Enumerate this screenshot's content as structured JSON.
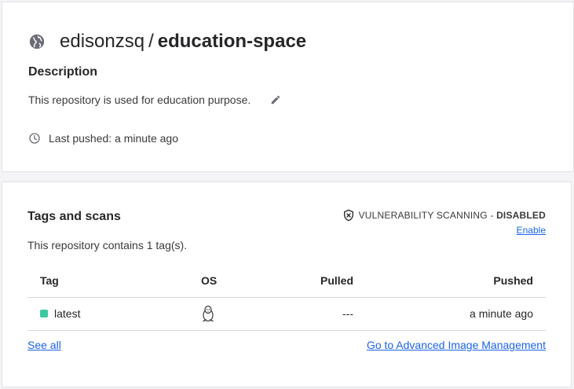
{
  "repo": {
    "owner": "edisonzsq",
    "separator": "/",
    "name": "education-space",
    "description_heading": "Description",
    "description": "This repository is used for education purpose.",
    "last_pushed": "Last pushed: a minute ago",
    "icons": {
      "visibility": "globe-icon",
      "edit": "pencil-icon",
      "time": "clock-icon"
    }
  },
  "tags": {
    "heading": "Tags and scans",
    "vuln_label": "VULNERABILITY SCANNING - ",
    "vuln_state": "DISABLED",
    "enable_label": "Enable",
    "count_text": "This repository contains 1 tag(s).",
    "columns": [
      "Tag",
      "OS",
      "Pulled",
      "Pushed"
    ],
    "rows": [
      {
        "tag": "latest",
        "os": "linux-icon",
        "pulled": "---",
        "pushed": "a minute ago",
        "status_color": "#3cc8a0"
      }
    ],
    "see_all_label": "See all",
    "advanced_label": "Go to Advanced Image Management"
  },
  "colors": {
    "link": "#1d63ed",
    "text": "#27272a",
    "background": "#f4f4f6"
  }
}
